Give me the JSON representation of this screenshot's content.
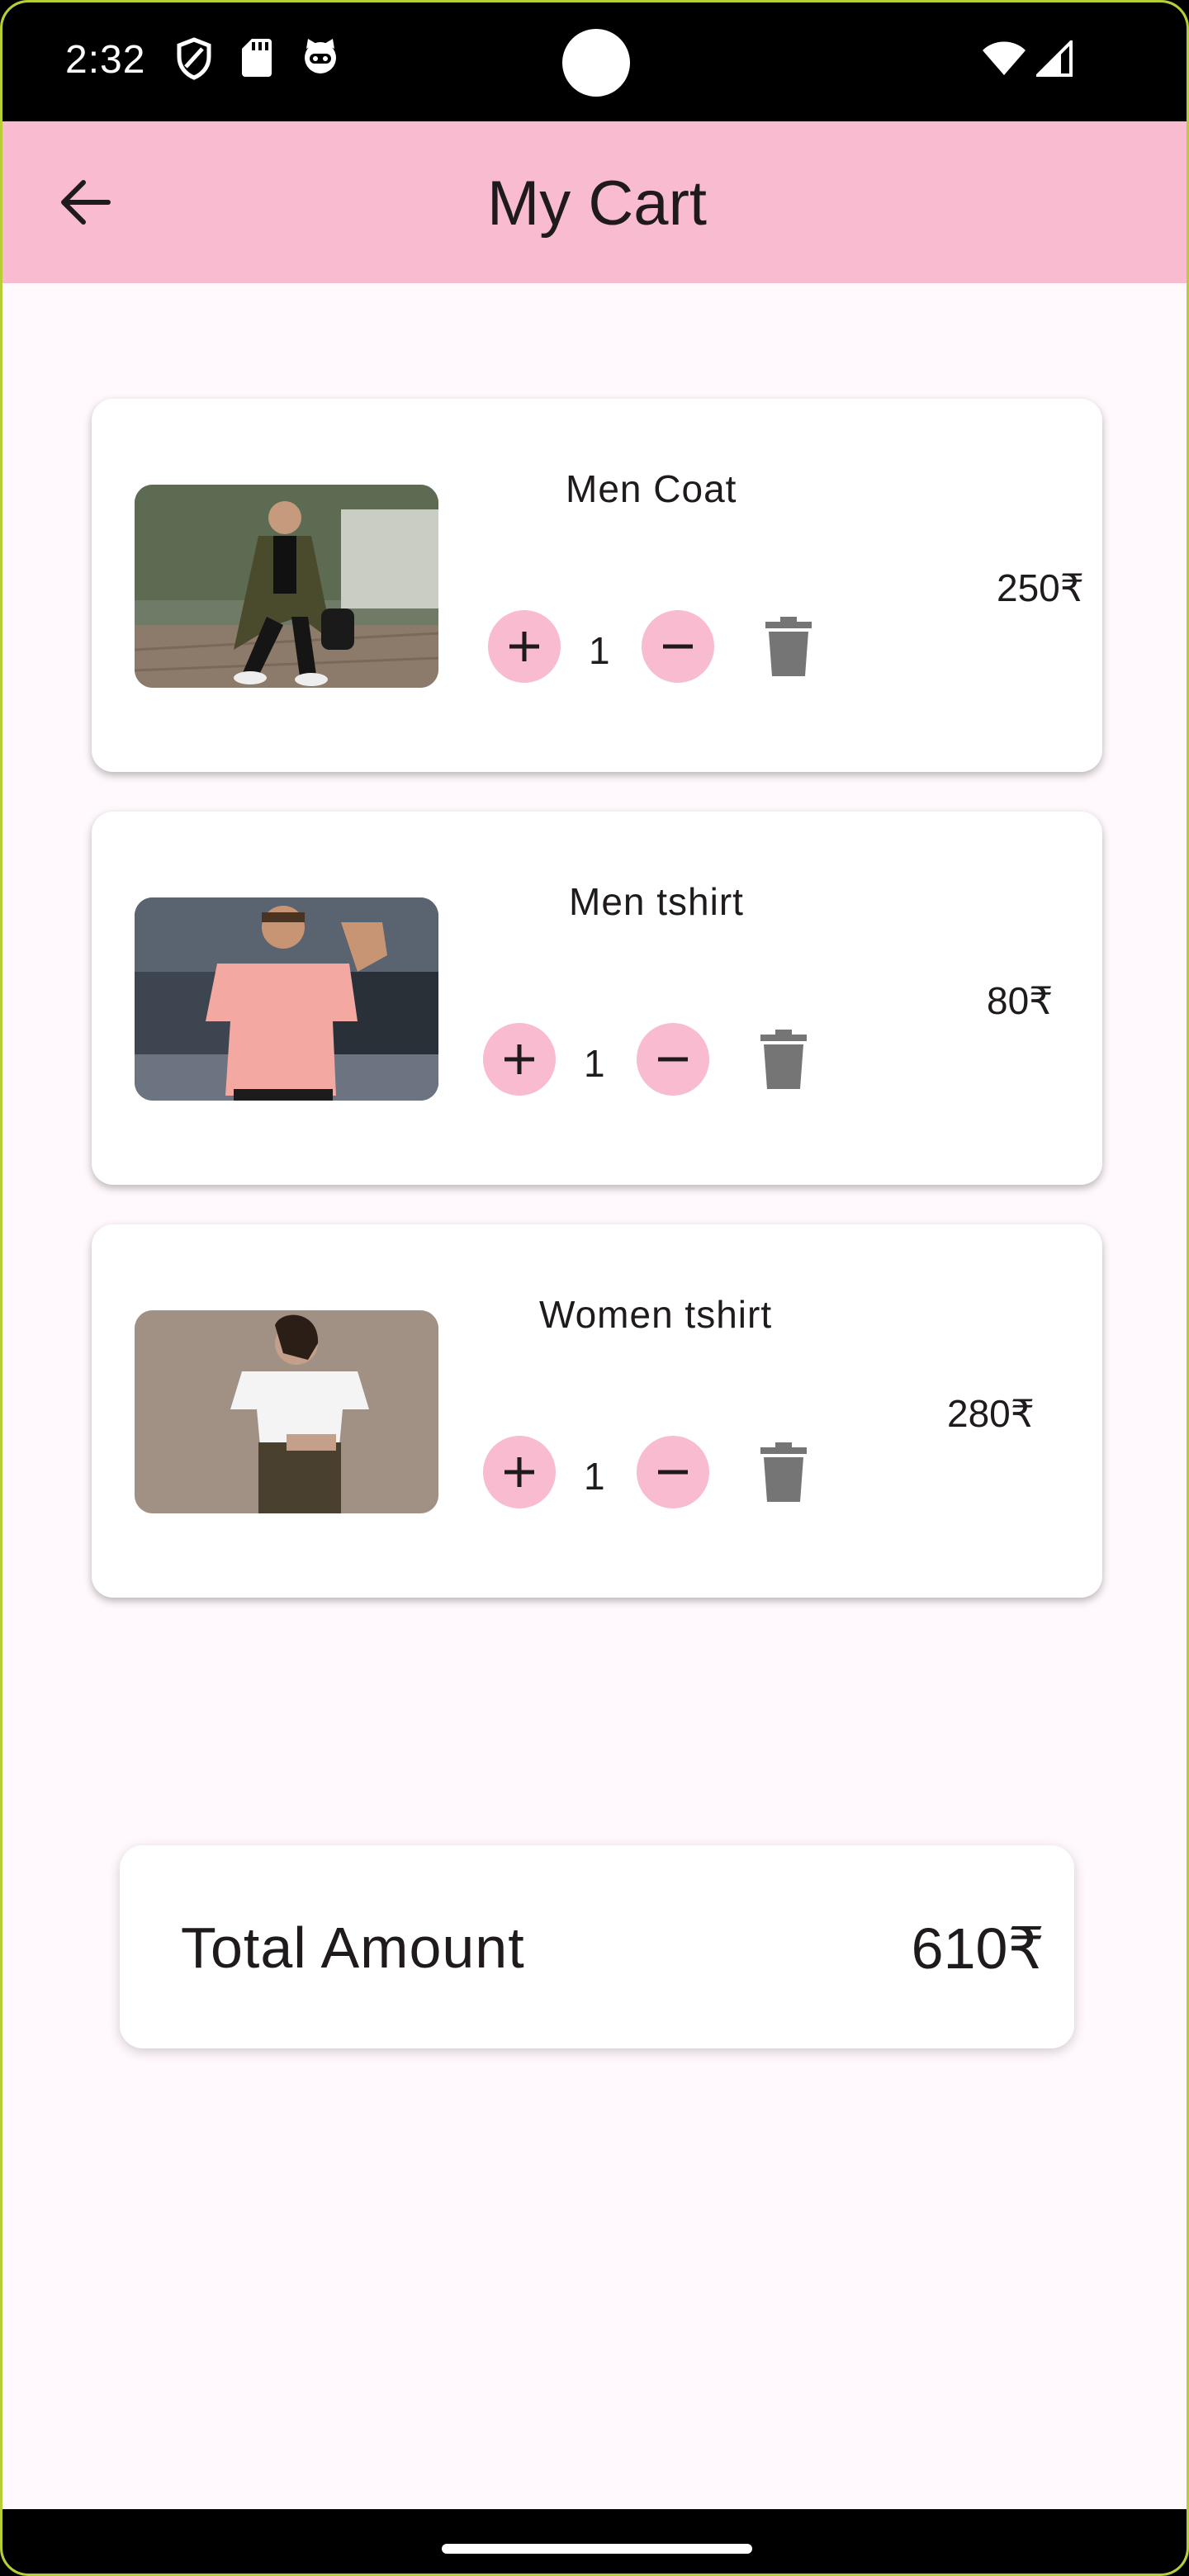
{
  "status_bar": {
    "time": "2:32",
    "icons": [
      "shield-icon",
      "sd-card-icon",
      "cat-face-icon",
      "wifi-icon",
      "signal-icon"
    ]
  },
  "app_bar": {
    "title": "My Cart",
    "back_icon": "arrow-back-icon"
  },
  "cart": {
    "items": [
      {
        "name": "Men Coat",
        "quantity": "1",
        "price": "250₹",
        "image": "man-in-olive-coat-photo"
      },
      {
        "name": "Men tshirt",
        "quantity": "1",
        "price": "80₹",
        "image": "man-in-pink-tshirt-photo"
      },
      {
        "name": "Women tshirt",
        "quantity": "1",
        "price": "280₹",
        "image": "woman-in-white-tshirt-photo"
      }
    ]
  },
  "total": {
    "label": "Total Amount",
    "value": "610₹"
  },
  "colors": {
    "app_bar": "#f8bbd0",
    "background": "#fff8fc",
    "button": "#f8bbd0",
    "trash": "#757575",
    "text": "#1f1a1d"
  }
}
